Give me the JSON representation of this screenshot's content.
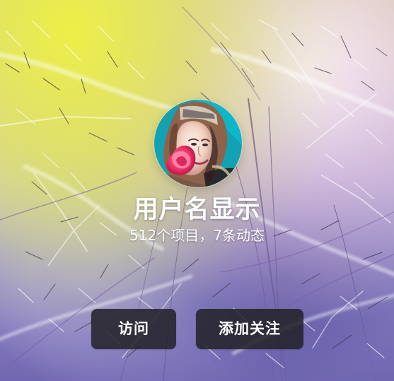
{
  "profile": {
    "username": "用户名显示",
    "stats": "512个项目，7条动态",
    "avatar_icon": "user-avatar-photo"
  },
  "actions": {
    "visit_label": "访问",
    "follow_label": "添加关注"
  },
  "colors": {
    "button_background": "#232228",
    "text": "#ffffff",
    "background_yellow": "#e9ea4d",
    "background_purple": "#6e6aa8",
    "avatar_teal": "#18a7b7",
    "flower_pink": "#ff3d6e"
  }
}
